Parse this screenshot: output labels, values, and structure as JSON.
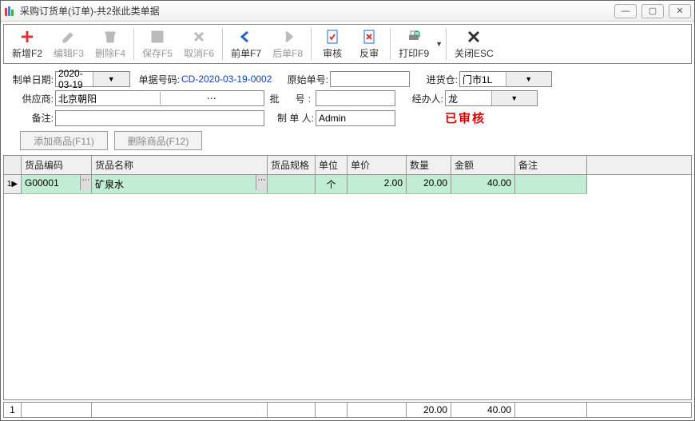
{
  "window": {
    "title": "采购订货单(订单)-共2张此类单据"
  },
  "toolbar": {
    "new": "新增F2",
    "edit": "编辑F3",
    "delete": "删除F4",
    "save": "保存F5",
    "cancel": "取消F6",
    "prev": "前单F7",
    "next": "后单F8",
    "audit": "审核",
    "unaudit": "反审",
    "print": "打印F9",
    "close": "关闭ESC"
  },
  "form": {
    "date_label": "制单日期:",
    "date_value": "2020-03-19",
    "billno_label": "单据号码:",
    "billno_value": "CD-2020-03-19-0002",
    "orig_label": "原始单号:",
    "orig_value": "",
    "wh_label": "进货仓:",
    "wh_value": "门市1L",
    "supplier_label": "供应商:",
    "supplier_value": "北京朝阳",
    "batch_label": "批　号:",
    "batch_value": "",
    "handler_label": "经办人:",
    "handler_value": "龙",
    "remark_label": "备注:",
    "remark_value": "",
    "maker_label": "制 单 人:",
    "maker_value": "Admin",
    "status": "已审核"
  },
  "buttons": {
    "add": "添加商品(F11)",
    "del": "删除商品(F12)"
  },
  "grid": {
    "headers": {
      "code": "货品编码",
      "name": "货品名称",
      "spec": "货品规格",
      "unit": "单位",
      "price": "单价",
      "qty": "数量",
      "amt": "金额",
      "remark": "备注"
    },
    "rows": [
      {
        "code": "G00001",
        "name": "矿泉水",
        "spec": "",
        "unit": "个",
        "price": "2.00",
        "qty": "20.00",
        "amt": "40.00",
        "remark": ""
      }
    ],
    "footer": {
      "idx": "1",
      "qty": "20.00",
      "amt": "40.00"
    }
  }
}
